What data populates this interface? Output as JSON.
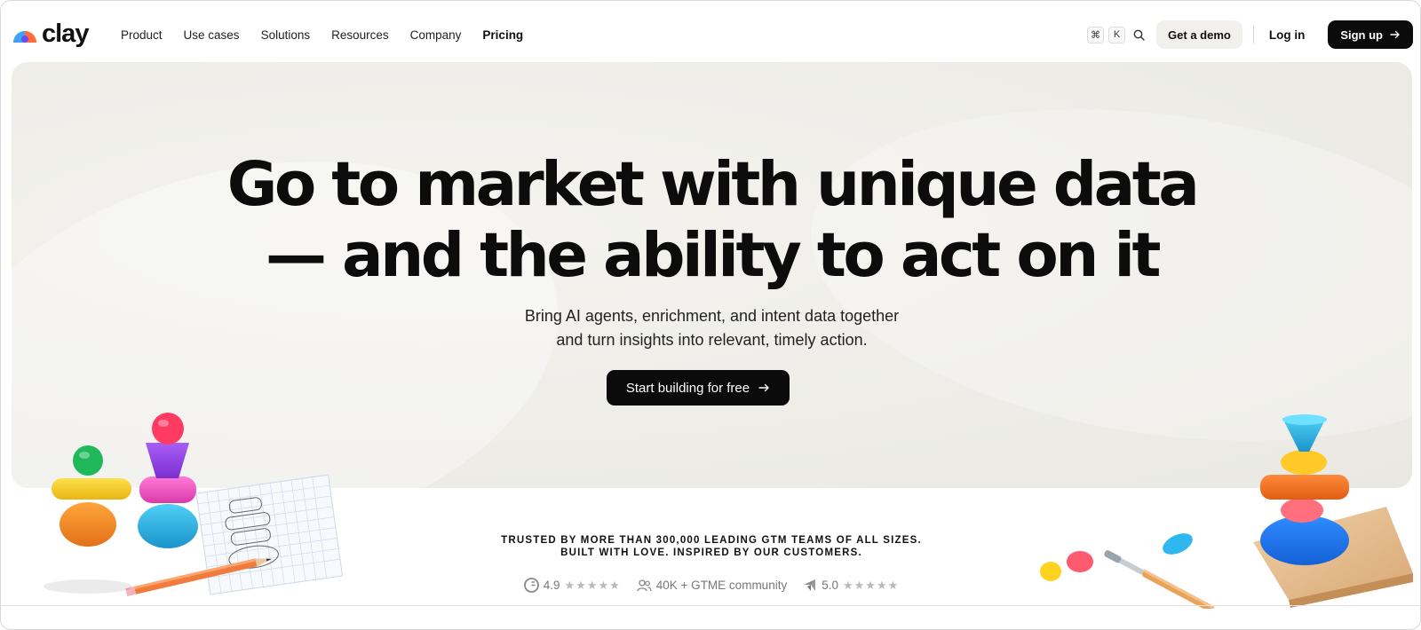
{
  "brand": {
    "logo_text": "clay"
  },
  "nav": {
    "links": [
      "Product",
      "Use cases",
      "Solutions",
      "Resources",
      "Company",
      "Pricing"
    ],
    "shortcut_cmd": "⌘",
    "shortcut_key": "K",
    "get_demo_label": "Get a demo",
    "login_label": "Log in",
    "signup_label": "Sign up"
  },
  "hero": {
    "headline_line1": "Go to market with unique data",
    "headline_line2": "— and the ability to act on it",
    "subhead_line1": "Bring AI agents, enrichment, and intent data together",
    "subhead_line2": "and turn insights into relevant, timely action.",
    "cta_label": "Start building for free"
  },
  "trust": {
    "line1": "TRUSTED BY MORE THAN 300,000 LEADING GTM TEAMS OF ALL SIZES.",
    "line2": "BUILT WITH LOVE. INSPIRED BY OUR CUSTOMERS."
  },
  "ratings": {
    "g2_rating": "4.9",
    "community": "40K + GTME community",
    "capterra_rating": "5.0",
    "stars": "★★★★★"
  },
  "colors": {
    "accent_dark": "#0b0b0b",
    "hero_bg": "#eeede8",
    "demo_bg": "#f1f0ec"
  }
}
